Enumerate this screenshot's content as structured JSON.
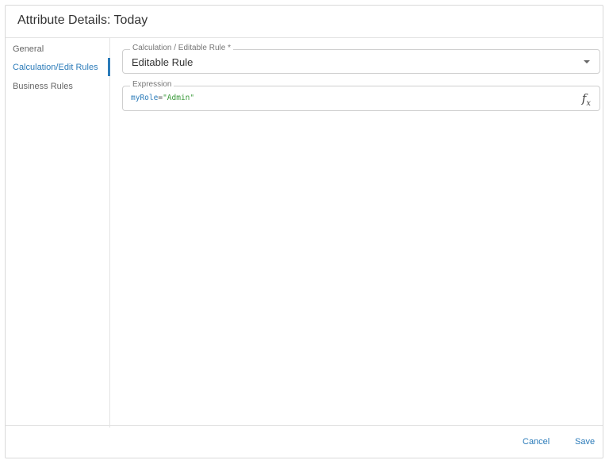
{
  "dialog": {
    "title": "Attribute Details: Today"
  },
  "sidebar": {
    "items": [
      {
        "label": "General",
        "active": false
      },
      {
        "label": "Calculation/Edit Rules",
        "active": true
      },
      {
        "label": "Business Rules",
        "active": false
      }
    ]
  },
  "rule_select": {
    "label": "Calculation / Editable Rule *",
    "value": "Editable Rule",
    "icon": "chevron-down-icon"
  },
  "expression": {
    "label": "Expression",
    "variable": "myRole",
    "operator": "=",
    "string_value": "\"Admin\"",
    "icon": "function-icon"
  },
  "footer": {
    "cancel_label": "Cancel",
    "save_label": "Save"
  },
  "colors": {
    "accent": "#2b7bb9",
    "string_literal": "#3a9a3a"
  }
}
